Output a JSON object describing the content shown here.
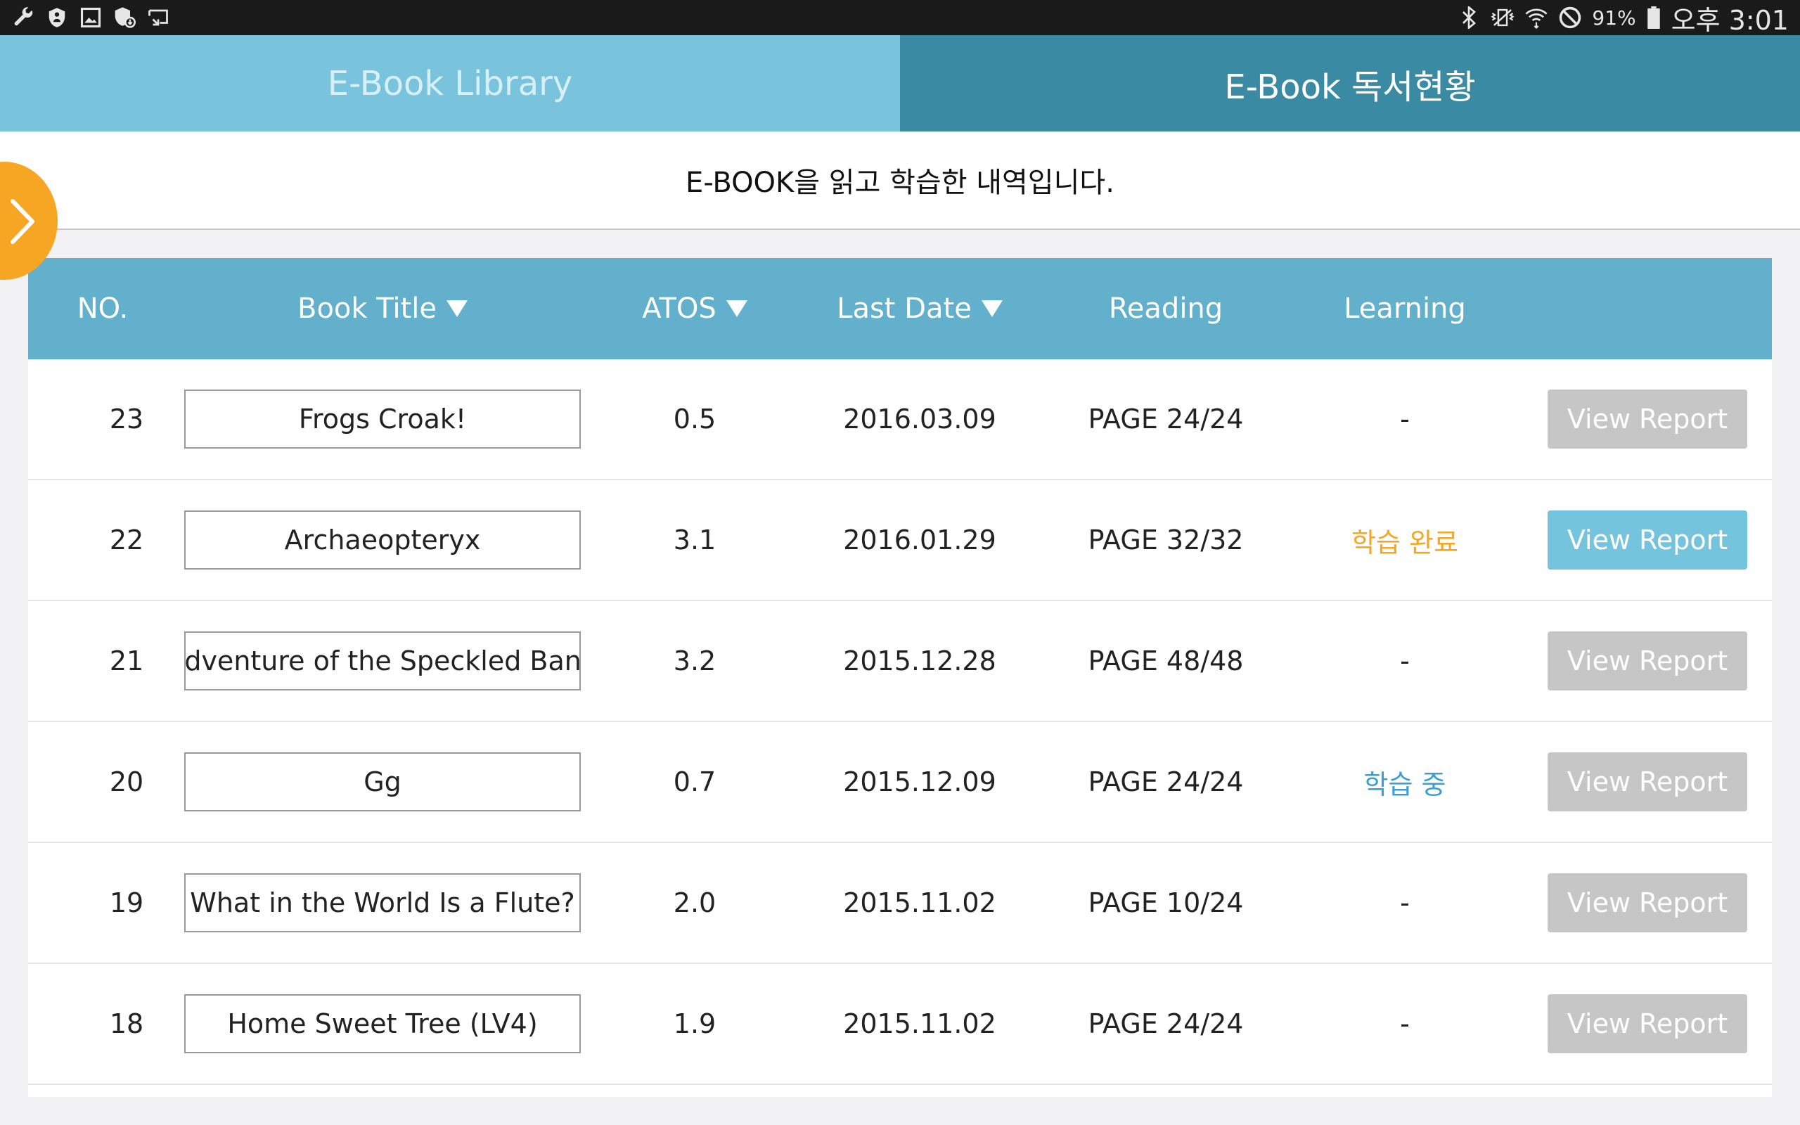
{
  "status_bar": {
    "icons_left": [
      "wrench-icon",
      "shield-icon",
      "image-icon",
      "security-update-icon",
      "cast-icon"
    ],
    "battery": "91%",
    "time": "오후 3:01",
    "icons_right": [
      "bluetooth-icon",
      "vibrate-icon",
      "wifi-icon",
      "no-symbol-icon",
      "battery-icon"
    ]
  },
  "tabs": [
    {
      "label": "E-Book Library",
      "active": false
    },
    {
      "label": "E-Book 독서현황",
      "active": true
    }
  ],
  "description": "E-BOOK을 읽고 학습한 내역입니다.",
  "table": {
    "headers": {
      "no": "NO.",
      "title": "Book Title",
      "atos": "ATOS",
      "last_date": "Last Date",
      "reading": "Reading",
      "learning": "Learning"
    },
    "rows": [
      {
        "no": "23",
        "title": "Frogs Croak!",
        "atos": "0.5",
        "date": "2016.03.09",
        "reading": "PAGE 24/24",
        "learning": "-",
        "learning_state": "none",
        "button": "View Report",
        "button_enabled": false
      },
      {
        "no": "22",
        "title": "Archaeopteryx",
        "atos": "3.1",
        "date": "2016.01.29",
        "reading": "PAGE 32/32",
        "learning": "학습 완료",
        "learning_state": "done",
        "button": "View Report",
        "button_enabled": true
      },
      {
        "no": "21",
        "title": "Adventure of the Speckled Band",
        "atos": "3.2",
        "date": "2015.12.28",
        "reading": "PAGE 48/48",
        "learning": "-",
        "learning_state": "none",
        "button": "View Report",
        "button_enabled": false
      },
      {
        "no": "20",
        "title": "Gg",
        "atos": "0.7",
        "date": "2015.12.09",
        "reading": "PAGE 24/24",
        "learning": "학습 중",
        "learning_state": "in_progress",
        "button": "View Report",
        "button_enabled": false
      },
      {
        "no": "19",
        "title": "What in the World Is a Flute?",
        "atos": "2.0",
        "date": "2015.11.02",
        "reading": "PAGE 10/24",
        "learning": "-",
        "learning_state": "none",
        "button": "View Report",
        "button_enabled": false
      },
      {
        "no": "18",
        "title": "Home Sweet Tree (LV4)",
        "atos": "1.9",
        "date": "2015.11.02",
        "reading": "PAGE 24/24",
        "learning": "-",
        "learning_state": "none",
        "button": "View Report",
        "button_enabled": false
      }
    ]
  },
  "colors": {
    "tab_inactive": "#79c4dc",
    "tab_active": "#3a8aa4",
    "table_header": "#62b0cc",
    "button_enabled": "#74c4dd",
    "button_disabled": "#c6c6c6",
    "learning_done": "#f5a623",
    "learning_in_progress": "#3b9fd0",
    "handle": "#f6a623"
  }
}
